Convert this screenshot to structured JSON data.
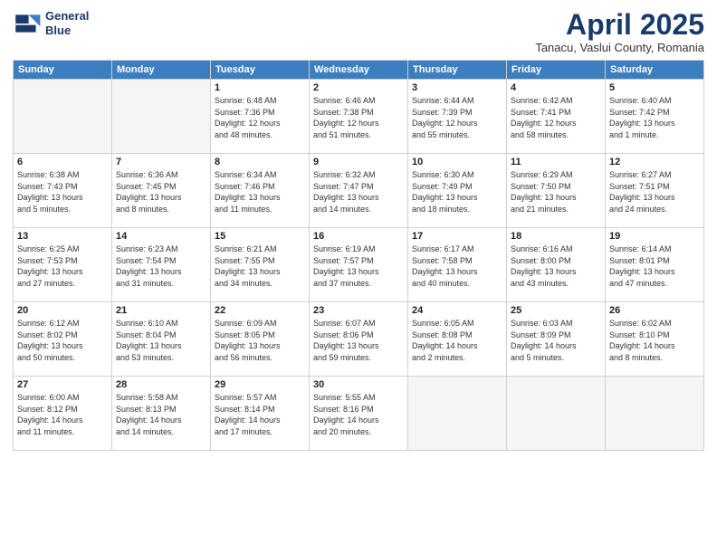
{
  "header": {
    "logo_line1": "General",
    "logo_line2": "Blue",
    "month_title": "April 2025",
    "subtitle": "Tanacu, Vaslui County, Romania"
  },
  "weekdays": [
    "Sunday",
    "Monday",
    "Tuesday",
    "Wednesday",
    "Thursday",
    "Friday",
    "Saturday"
  ],
  "weeks": [
    [
      {
        "day": "",
        "detail": ""
      },
      {
        "day": "",
        "detail": ""
      },
      {
        "day": "1",
        "detail": "Sunrise: 6:48 AM\nSunset: 7:36 PM\nDaylight: 12 hours\nand 48 minutes."
      },
      {
        "day": "2",
        "detail": "Sunrise: 6:46 AM\nSunset: 7:38 PM\nDaylight: 12 hours\nand 51 minutes."
      },
      {
        "day": "3",
        "detail": "Sunrise: 6:44 AM\nSunset: 7:39 PM\nDaylight: 12 hours\nand 55 minutes."
      },
      {
        "day": "4",
        "detail": "Sunrise: 6:42 AM\nSunset: 7:41 PM\nDaylight: 12 hours\nand 58 minutes."
      },
      {
        "day": "5",
        "detail": "Sunrise: 6:40 AM\nSunset: 7:42 PM\nDaylight: 13 hours\nand 1 minute."
      }
    ],
    [
      {
        "day": "6",
        "detail": "Sunrise: 6:38 AM\nSunset: 7:43 PM\nDaylight: 13 hours\nand 5 minutes."
      },
      {
        "day": "7",
        "detail": "Sunrise: 6:36 AM\nSunset: 7:45 PM\nDaylight: 13 hours\nand 8 minutes."
      },
      {
        "day": "8",
        "detail": "Sunrise: 6:34 AM\nSunset: 7:46 PM\nDaylight: 13 hours\nand 11 minutes."
      },
      {
        "day": "9",
        "detail": "Sunrise: 6:32 AM\nSunset: 7:47 PM\nDaylight: 13 hours\nand 14 minutes."
      },
      {
        "day": "10",
        "detail": "Sunrise: 6:30 AM\nSunset: 7:49 PM\nDaylight: 13 hours\nand 18 minutes."
      },
      {
        "day": "11",
        "detail": "Sunrise: 6:29 AM\nSunset: 7:50 PM\nDaylight: 13 hours\nand 21 minutes."
      },
      {
        "day": "12",
        "detail": "Sunrise: 6:27 AM\nSunset: 7:51 PM\nDaylight: 13 hours\nand 24 minutes."
      }
    ],
    [
      {
        "day": "13",
        "detail": "Sunrise: 6:25 AM\nSunset: 7:53 PM\nDaylight: 13 hours\nand 27 minutes."
      },
      {
        "day": "14",
        "detail": "Sunrise: 6:23 AM\nSunset: 7:54 PM\nDaylight: 13 hours\nand 31 minutes."
      },
      {
        "day": "15",
        "detail": "Sunrise: 6:21 AM\nSunset: 7:55 PM\nDaylight: 13 hours\nand 34 minutes."
      },
      {
        "day": "16",
        "detail": "Sunrise: 6:19 AM\nSunset: 7:57 PM\nDaylight: 13 hours\nand 37 minutes."
      },
      {
        "day": "17",
        "detail": "Sunrise: 6:17 AM\nSunset: 7:58 PM\nDaylight: 13 hours\nand 40 minutes."
      },
      {
        "day": "18",
        "detail": "Sunrise: 6:16 AM\nSunset: 8:00 PM\nDaylight: 13 hours\nand 43 minutes."
      },
      {
        "day": "19",
        "detail": "Sunrise: 6:14 AM\nSunset: 8:01 PM\nDaylight: 13 hours\nand 47 minutes."
      }
    ],
    [
      {
        "day": "20",
        "detail": "Sunrise: 6:12 AM\nSunset: 8:02 PM\nDaylight: 13 hours\nand 50 minutes."
      },
      {
        "day": "21",
        "detail": "Sunrise: 6:10 AM\nSunset: 8:04 PM\nDaylight: 13 hours\nand 53 minutes."
      },
      {
        "day": "22",
        "detail": "Sunrise: 6:09 AM\nSunset: 8:05 PM\nDaylight: 13 hours\nand 56 minutes."
      },
      {
        "day": "23",
        "detail": "Sunrise: 6:07 AM\nSunset: 8:06 PM\nDaylight: 13 hours\nand 59 minutes."
      },
      {
        "day": "24",
        "detail": "Sunrise: 6:05 AM\nSunset: 8:08 PM\nDaylight: 14 hours\nand 2 minutes."
      },
      {
        "day": "25",
        "detail": "Sunrise: 6:03 AM\nSunset: 8:09 PM\nDaylight: 14 hours\nand 5 minutes."
      },
      {
        "day": "26",
        "detail": "Sunrise: 6:02 AM\nSunset: 8:10 PM\nDaylight: 14 hours\nand 8 minutes."
      }
    ],
    [
      {
        "day": "27",
        "detail": "Sunrise: 6:00 AM\nSunset: 8:12 PM\nDaylight: 14 hours\nand 11 minutes."
      },
      {
        "day": "28",
        "detail": "Sunrise: 5:58 AM\nSunset: 8:13 PM\nDaylight: 14 hours\nand 14 minutes."
      },
      {
        "day": "29",
        "detail": "Sunrise: 5:57 AM\nSunset: 8:14 PM\nDaylight: 14 hours\nand 17 minutes."
      },
      {
        "day": "30",
        "detail": "Sunrise: 5:55 AM\nSunset: 8:16 PM\nDaylight: 14 hours\nand 20 minutes."
      },
      {
        "day": "",
        "detail": ""
      },
      {
        "day": "",
        "detail": ""
      },
      {
        "day": "",
        "detail": ""
      }
    ]
  ]
}
